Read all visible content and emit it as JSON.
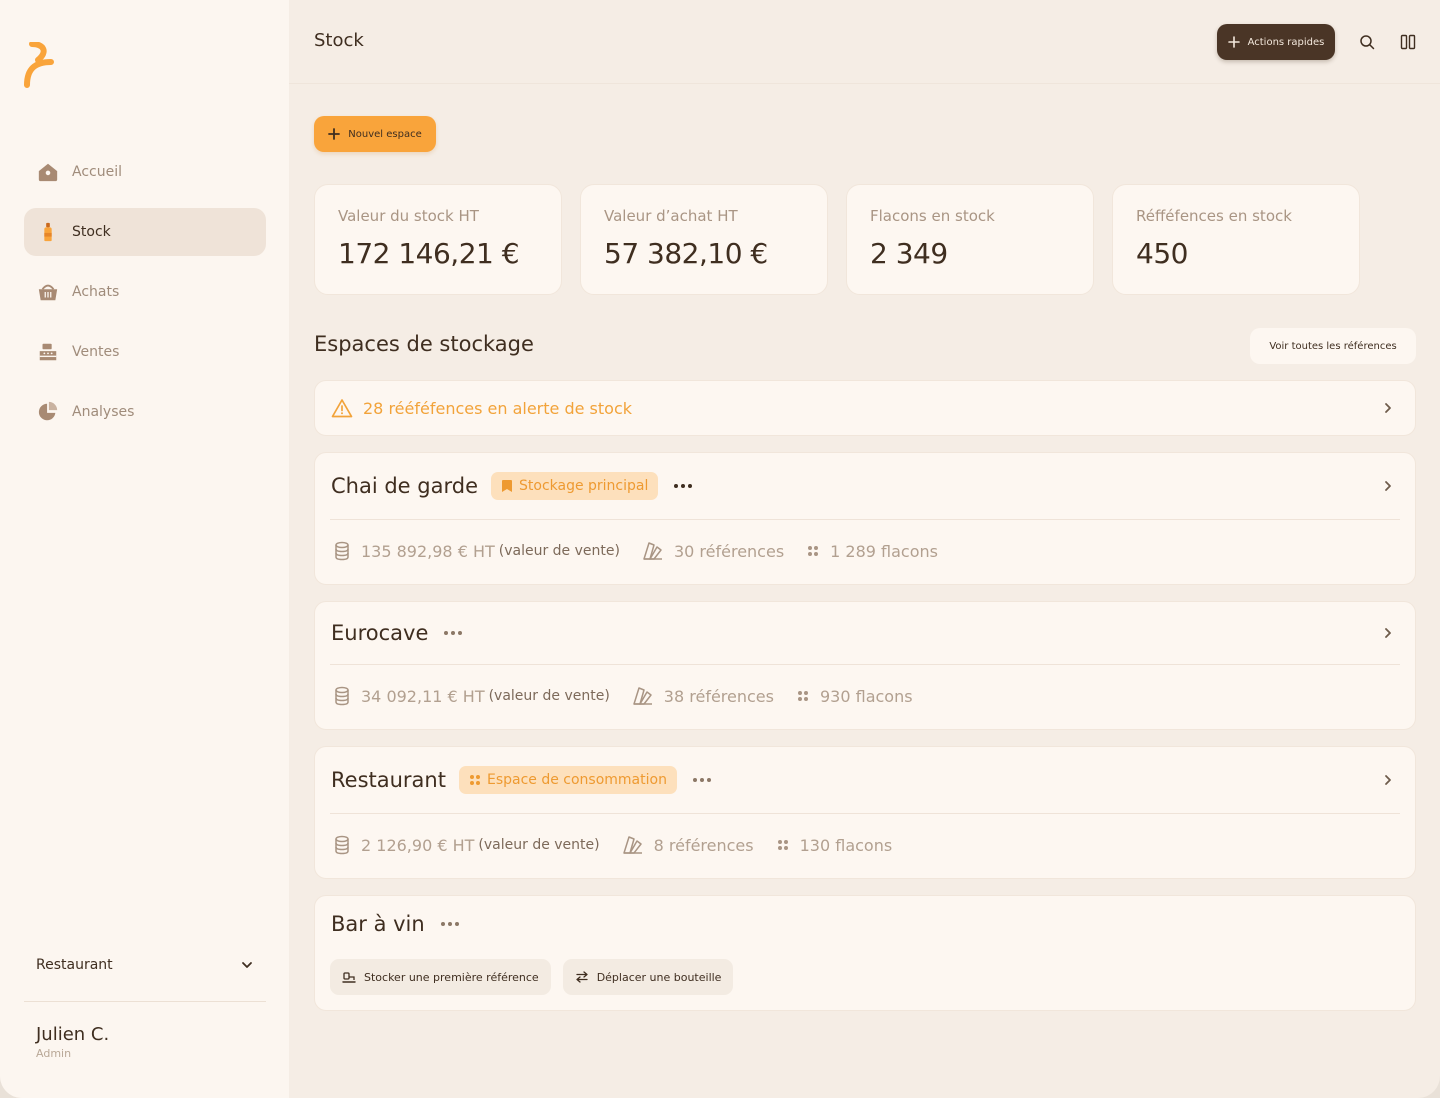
{
  "colors": {
    "accent": "#f9a43b",
    "dark": "#4a3526",
    "alert": "#f2a33a"
  },
  "sidebar": {
    "items": [
      {
        "label": "Accueil",
        "icon": "house-icon"
      },
      {
        "label": "Stock",
        "icon": "bottle-icon",
        "active": true
      },
      {
        "label": "Achats",
        "icon": "basket-icon"
      },
      {
        "label": "Ventes",
        "icon": "cash-register-icon"
      },
      {
        "label": "Analyses",
        "icon": "pie-chart-icon"
      }
    ],
    "site_select": "Restaurant",
    "user": {
      "name": "Julien C.",
      "role": "Admin"
    }
  },
  "header": {
    "title": "Stock",
    "quick_actions_label": "Actions rapides"
  },
  "new_space_label": "Nouvel espace",
  "stats": [
    {
      "label": "Valeur du stock HT",
      "value": "172 146,21 €"
    },
    {
      "label": "Valeur d’achat HT",
      "value": "57 382,10 €"
    },
    {
      "label": "Flacons en stock",
      "value": "2 349"
    },
    {
      "label": "Réfféfences en stock",
      "value": "450"
    }
  ],
  "section": {
    "title": "Espaces de stockage",
    "see_all_label": "Voir toutes les références"
  },
  "alert": {
    "text": "28 rééféfences en alerte de stock"
  },
  "spaces": [
    {
      "name": "Chai de garde",
      "tag": "Stockage principal",
      "value": "135 892,98 € HT",
      "value_note": "(valeur de vente)",
      "references": "30 références",
      "bottles": "1 289 flacons"
    },
    {
      "name": "Eurocave",
      "value": "34 092,11 € HT",
      "value_note": "(valeur de vente)",
      "references": "38 références",
      "bottles": "930 flacons"
    },
    {
      "name": "Restaurant",
      "tag": "Espace de consommation",
      "value": "2 126,90 € HT",
      "value_note": "(valeur de vente)",
      "references": "8 références",
      "bottles": "130 flacons"
    },
    {
      "name": "Bar à vin",
      "actions": [
        "Stocker une première référence",
        "Déplacer une bouteille"
      ]
    }
  ]
}
